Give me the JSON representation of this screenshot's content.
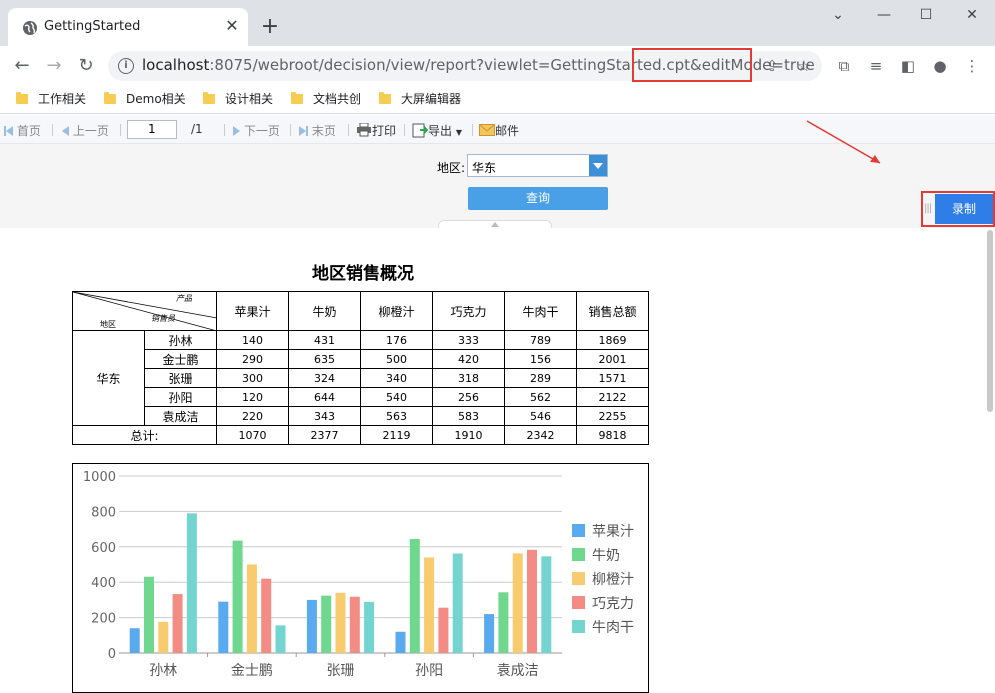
{
  "browser": {
    "tab_title": "GettingStarted",
    "tab_close": "✕",
    "new_tab": "+",
    "window_controls": {
      "minimize": "—",
      "maximize": "☐",
      "close": "✕"
    },
    "url_host": "localhost",
    "url_rest": ":8075/webroot/decision/view/report?viewlet=GettingStarted.cpt&editMode=true",
    "bookmarks": [
      "工作相关",
      "Demo相关",
      "设计相关",
      "文档共创",
      "大屏编辑器"
    ]
  },
  "toolbar": {
    "first": "首页",
    "prev": "上一页",
    "page_value": "1",
    "page_total": "/1",
    "next": "下一页",
    "last": "末页",
    "print": "打印",
    "export": "导出",
    "mail": "邮件"
  },
  "params": {
    "region_label": "地区:",
    "region_value": "华东",
    "query_label": "查询"
  },
  "record": {
    "label": "录制"
  },
  "report": {
    "title": "地区销售概况",
    "corner": {
      "product": "产品",
      "salesperson": "销售员",
      "region": "地区"
    },
    "columns": [
      "苹果汁",
      "牛奶",
      "柳橙汁",
      "巧克力",
      "牛肉干",
      "销售总额"
    ],
    "region": "华东",
    "rows": [
      {
        "name": "孙林",
        "values": [
          "140",
          "431",
          "176",
          "333",
          "789",
          "1869"
        ]
      },
      {
        "name": "金士鹏",
        "values": [
          "290",
          "635",
          "500",
          "420",
          "156",
          "2001"
        ]
      },
      {
        "name": "张珊",
        "values": [
          "300",
          "324",
          "340",
          "318",
          "289",
          "1571"
        ]
      },
      {
        "name": "孙阳",
        "values": [
          "120",
          "644",
          "540",
          "256",
          "562",
          "2122"
        ]
      },
      {
        "name": "袁成洁",
        "values": [
          "220",
          "343",
          "563",
          "583",
          "546",
          "2255"
        ]
      }
    ],
    "total_label": "总计:",
    "totals": [
      "1070",
      "2377",
      "2119",
      "1910",
      "2342",
      "9818"
    ]
  },
  "chart_data": {
    "type": "bar",
    "categories": [
      "孙林",
      "金士鹏",
      "张珊",
      "孙阳",
      "袁成洁"
    ],
    "series": [
      {
        "name": "苹果汁",
        "color": "#5aaaef",
        "values": [
          140,
          290,
          300,
          120,
          220
        ]
      },
      {
        "name": "牛奶",
        "color": "#6fd88e",
        "values": [
          431,
          635,
          324,
          644,
          343
        ]
      },
      {
        "name": "柳橙汁",
        "color": "#f8cb6e",
        "values": [
          176,
          500,
          340,
          540,
          563
        ]
      },
      {
        "name": "巧克力",
        "color": "#f38c84",
        "values": [
          333,
          420,
          318,
          256,
          583
        ]
      },
      {
        "name": "牛肉干",
        "color": "#74d4d0",
        "values": [
          789,
          156,
          289,
          562,
          546
        ]
      }
    ],
    "yticks": [
      "0",
      "200",
      "400",
      "600",
      "800",
      "1000"
    ],
    "ylim": [
      0,
      1000
    ],
    "grid": true,
    "legend": "right"
  }
}
